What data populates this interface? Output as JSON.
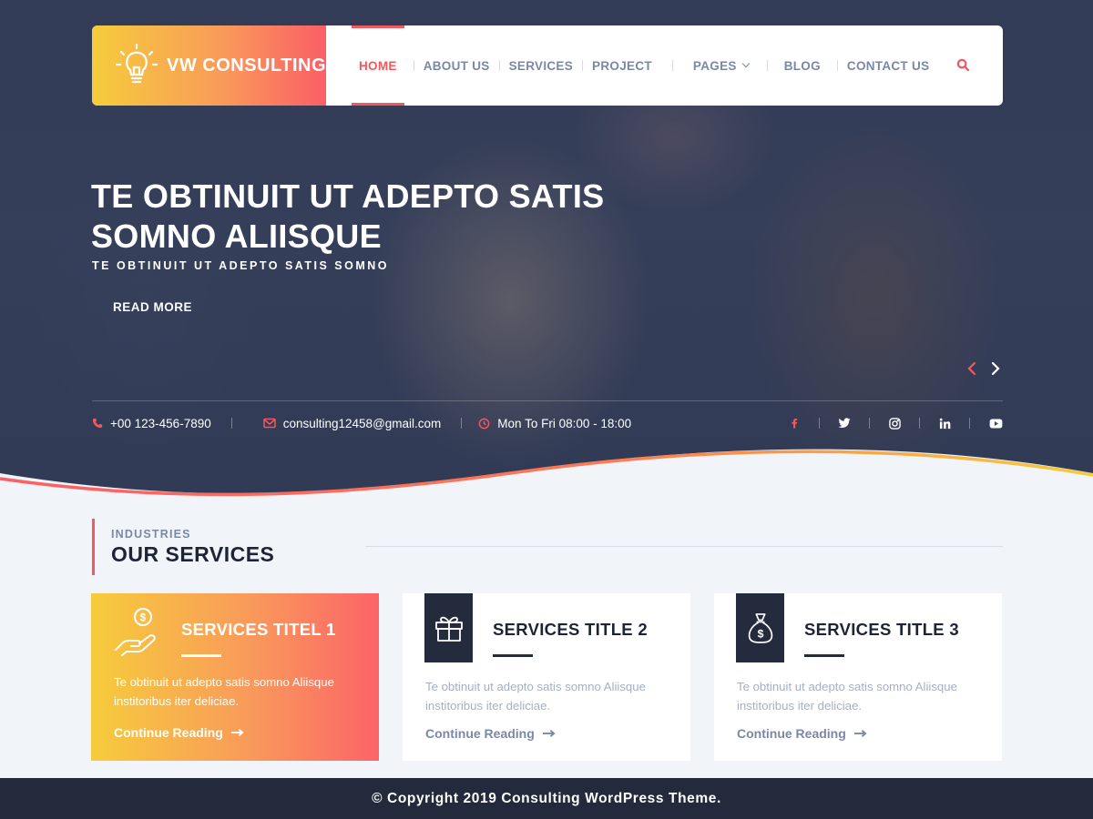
{
  "brand": {
    "name": "VW CONSULTING",
    "logo_icon": "lightbulb-icon"
  },
  "nav": {
    "items": [
      {
        "label": "HOME",
        "active": true
      },
      {
        "label": "ABOUT US"
      },
      {
        "label": "SERVICES"
      },
      {
        "label": "PROJECT"
      },
      {
        "label": "PAGES",
        "has_dropdown": true
      },
      {
        "label": "BLOG"
      },
      {
        "label": "CONTACT US"
      }
    ],
    "search_icon": "search-icon"
  },
  "hero": {
    "title": "TE OBTINUIT UT ADEPTO SATIS SOMNO ALIISQUE",
    "subtitle": "TE OBTINUIT UT ADEPTO SATIS SOMNO",
    "cta": "READ MORE"
  },
  "contact": {
    "phone": "+00 123-456-7890",
    "email": "consulting12458@gmail.com",
    "hours": "Mon To Fri 08:00 - 18:00"
  },
  "social": [
    "facebook-icon",
    "twitter-icon",
    "instagram-icon",
    "linkedin-icon",
    "youtube-icon"
  ],
  "services_section": {
    "kicker": "INDUSTRIES",
    "title": "OUR SERVICES"
  },
  "services": [
    {
      "title": "SERVICES TITEL 1",
      "text": "Te obtinuit ut adepto satis somno Aliisque institoribus iter deliciae.",
      "link": "Continue Reading",
      "icon": "hand-coin-icon",
      "featured": true
    },
    {
      "title": "SERVICES TITLE 2",
      "text": "Te obtinuit ut adepto satis somno Aliisque institoribus iter deliciae.",
      "link": "Continue Reading",
      "icon": "gift-icon"
    },
    {
      "title": "SERVICES TITLE 3",
      "text": "Te obtinuit ut adepto satis somno Aliisque institoribus iter deliciae.",
      "link": "Continue Reading",
      "icon": "money-bag-icon"
    }
  ],
  "footer": {
    "text": "© Copyright 2019 Consulting WordPress Theme."
  },
  "colors": {
    "accent": "#f5575f",
    "dark": "#222a3b",
    "muted": "#7b88a3",
    "gradient_start": "#f6cc3c",
    "gradient_end": "#fb5f66"
  }
}
